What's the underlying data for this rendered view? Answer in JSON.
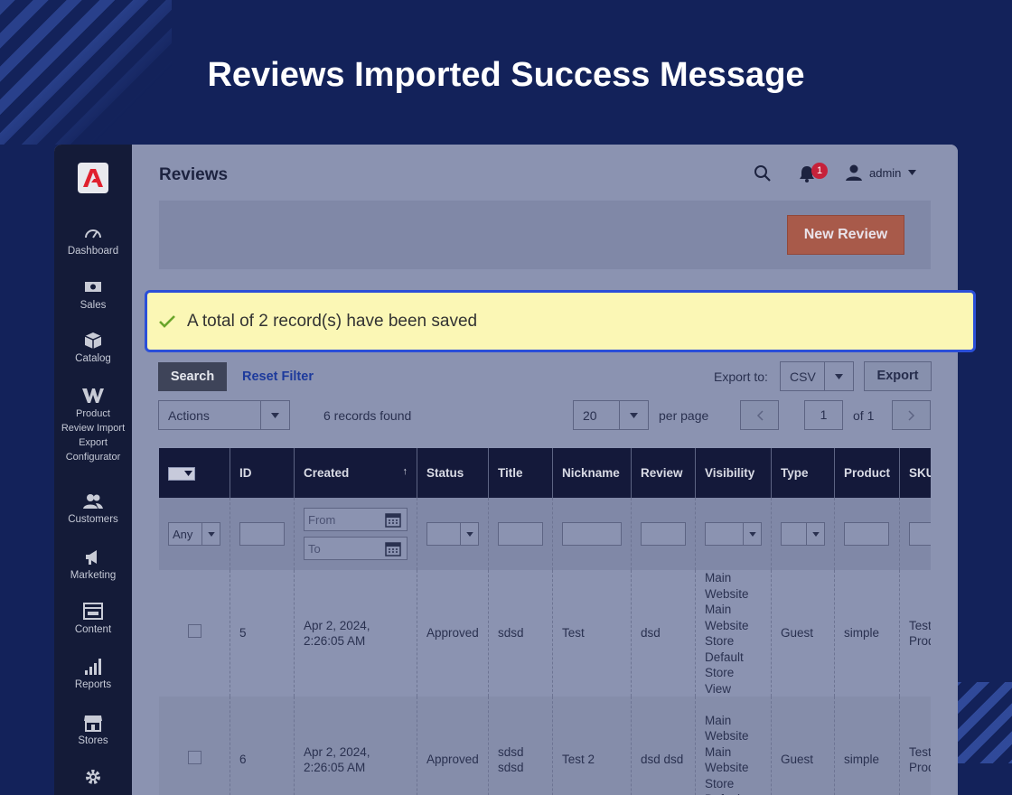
{
  "heading": "Reviews Imported Success Message",
  "sidebar": {
    "items": [
      {
        "label": "Dashboard",
        "icon": "dashboard-icon"
      },
      {
        "label": "Sales",
        "icon": "dollar-icon"
      },
      {
        "label": "Catalog",
        "icon": "cube-icon"
      },
      {
        "label": "Product Review Import Export Configurator",
        "icon": "w-logo-icon"
      },
      {
        "label": "Customers",
        "icon": "users-icon"
      },
      {
        "label": "Marketing",
        "icon": "megaphone-icon"
      },
      {
        "label": "Content",
        "icon": "layout-icon"
      },
      {
        "label": "Reports",
        "icon": "bar-chart-icon"
      },
      {
        "label": "Stores",
        "icon": "store-icon"
      },
      {
        "label": "",
        "icon": "gear-icon"
      }
    ]
  },
  "header": {
    "title": "Reviews",
    "notification_count": "1",
    "user": "admin"
  },
  "actions": {
    "new_review": "New Review"
  },
  "message": {
    "text": "A total of 2 record(s) have been saved"
  },
  "toolbar": {
    "search": "Search",
    "reset_filter": "Reset Filter",
    "export_to_label": "Export to:",
    "export_format": "CSV",
    "export_button": "Export",
    "actions_select": "Actions",
    "records_found": "6 records found",
    "per_page_value": "20",
    "per_page_label": "per page",
    "page_current": "1",
    "page_total": "of 1"
  },
  "grid": {
    "columns": [
      "ID",
      "Created",
      "Status",
      "Title",
      "Nickname",
      "Review",
      "Visibility",
      "Type",
      "Product",
      "SKU"
    ],
    "sort_indicator": "↑",
    "filters": {
      "id_any": "Any",
      "created_from": "From",
      "created_to": "To"
    },
    "rows": [
      {
        "id": "5",
        "created": "Apr 2, 2024, 2:26:05 AM",
        "status": "Approved",
        "title": "sdsd",
        "nickname": "Test",
        "review": "dsd",
        "visibility": "Main Website Main Website Store Default Store View",
        "type": "Guest",
        "product": "simple",
        "sku": "Test Prod"
      },
      {
        "id": "6",
        "created": "Apr 2, 2024, 2:26:05 AM",
        "status": "Approved",
        "title": "sdsd sdsd",
        "nickname": "Test 2",
        "review": "dsd dsd",
        "visibility": "Main Website Main Website Store Default",
        "type": "Guest",
        "product": "simple",
        "sku": "Test Prod"
      }
    ]
  },
  "colors": {
    "background": "#13225a",
    "message_bg": "#fbf7b5",
    "message_border": "#2b4fd8",
    "check": "#6aa52a",
    "new_review_btn": "#a85a4a"
  }
}
